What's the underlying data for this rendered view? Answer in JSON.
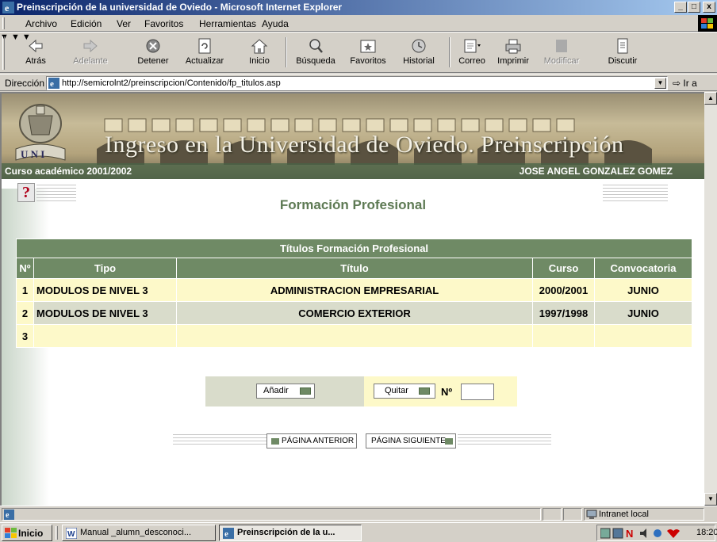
{
  "window": {
    "title": "Preinscripción de la universidad de Oviedo - Microsoft Internet Explorer",
    "min": "_",
    "max": "□",
    "close": "x"
  },
  "menu": [
    {
      "label": "Archivo"
    },
    {
      "label": "Edición"
    },
    {
      "label": "Ver"
    },
    {
      "label": "Favoritos"
    },
    {
      "label": "Herramientas"
    },
    {
      "label": "Ayuda"
    }
  ],
  "toolbar": {
    "back": "Atrás",
    "forward": "Adelante",
    "stop": "Detener",
    "refresh": "Actualizar",
    "home": "Inicio",
    "search": "Búsqueda",
    "favorites": "Favoritos",
    "history": "Historial",
    "mail": "Correo",
    "print": "Imprimir",
    "edit": "Modificar",
    "discuss": "Discutir"
  },
  "address": {
    "label": "Dirección",
    "url": "http://semicrolnt2/preinscripcion/Contenido/fp_titulos.asp",
    "go": "Ir a"
  },
  "banner": {
    "title": "Ingreso en la Universidad de Oviedo. Preinscripción",
    "course": "Curso académico 2001/2002",
    "user": "JOSE ANGEL GONZALEZ GOMEZ"
  },
  "help_glyph": "?",
  "page_heading": "Formación Profesional",
  "table": {
    "caption": "Títulos Formación Profesional",
    "columns": [
      "Nº",
      "Tipo",
      "Título",
      "Curso",
      "Convocatoria"
    ],
    "rows": [
      {
        "num": "1",
        "tipo": "MODULOS DE NIVEL 3",
        "titulo": "ADMINISTRACION EMPRESARIAL",
        "curso": "2000/2001",
        "convocatoria": "JUNIO"
      },
      {
        "num": "2",
        "tipo": "MODULOS DE NIVEL 3",
        "titulo": "COMERCIO EXTERIOR",
        "curso": "1997/1998",
        "convocatoria": "JUNIO"
      },
      {
        "num": "3",
        "tipo": "",
        "titulo": "",
        "curso": "",
        "convocatoria": ""
      }
    ]
  },
  "actions": {
    "add": "Añadir",
    "remove": "Quitar",
    "no_label": "Nº",
    "no_value": ""
  },
  "nav": {
    "prev": "PÁGINA ANTERIOR",
    "next": "PÁGINA SIGUIENTE"
  },
  "status": {
    "zone": "Intranet local"
  },
  "taskbar": {
    "start": "Inicio",
    "tasks": [
      {
        "label": "Manual _alumn_desconoci..."
      },
      {
        "label": "Preinscripción de la u..."
      }
    ],
    "clock": "18:20"
  },
  "colors": {
    "table_header": "#6f8a65",
    "row_light": "#fdf9c9",
    "row_alt": "#d9dccb",
    "heading": "#5e7a54"
  }
}
